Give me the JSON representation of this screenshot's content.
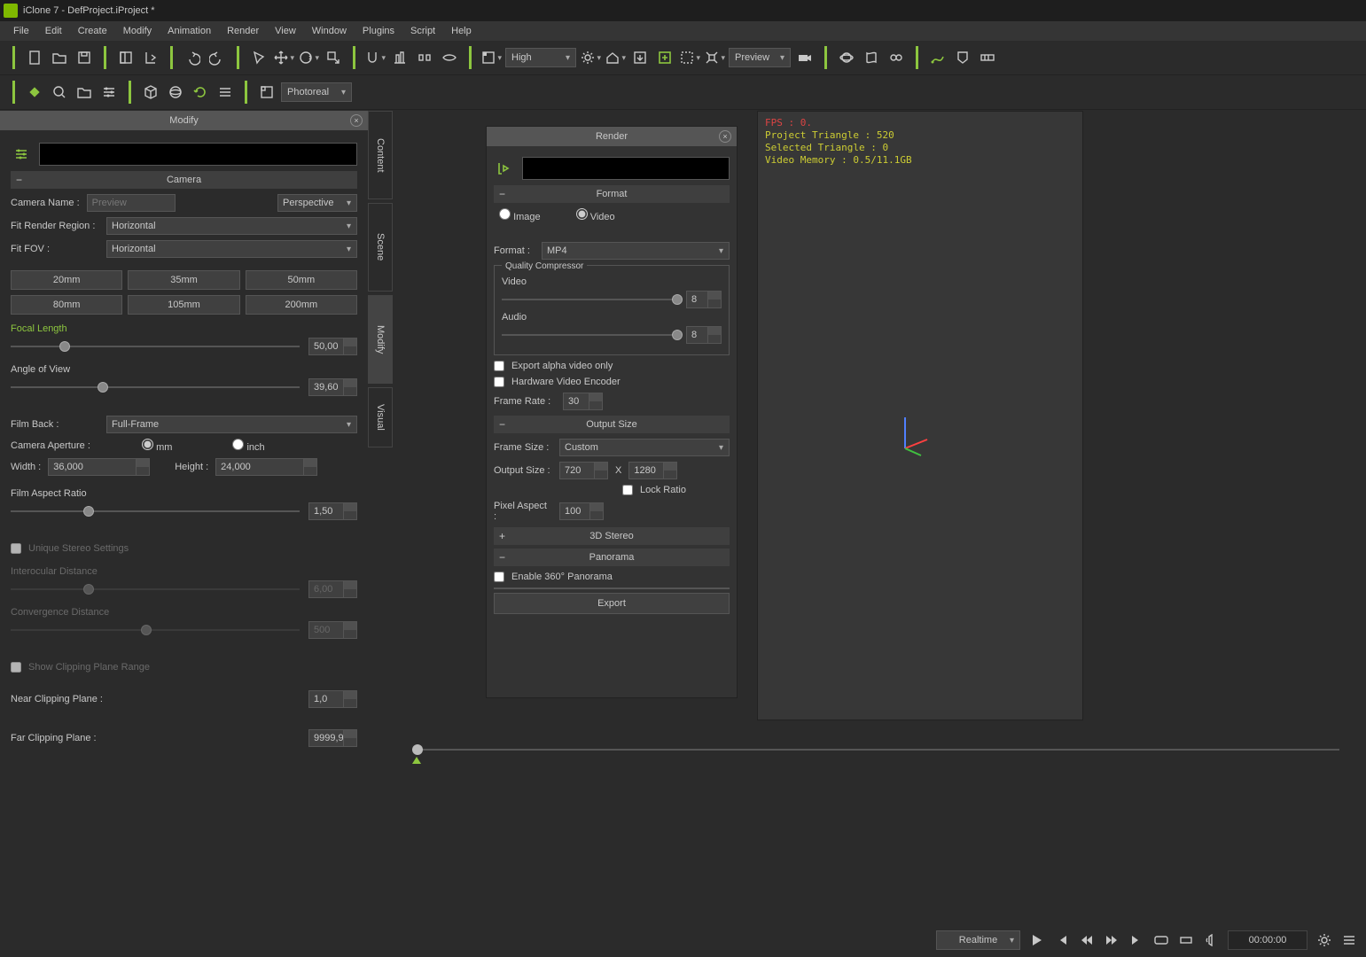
{
  "title": "iClone 7 - DefProject.iProject *",
  "menubar": [
    "File",
    "Edit",
    "Create",
    "Modify",
    "Animation",
    "Render",
    "View",
    "Window",
    "Plugins",
    "Script",
    "Help"
  ],
  "toolbar": {
    "quality_dropdown": "High",
    "preview_dropdown": "Preview",
    "shade_dropdown": "Photoreal"
  },
  "side_tabs": [
    "Content",
    "Scene",
    "Modify",
    "Visual"
  ],
  "modify": {
    "panel_title": "Modify",
    "search_value": "",
    "sections": {
      "camera": {
        "title": "Camera",
        "name_label": "Camera Name :",
        "name_value": "Preview",
        "projection": "Perspective",
        "fit_region_label": "Fit Render Region :",
        "fit_region_value": "Horizontal",
        "fit_fov_label": "Fit FOV :",
        "fit_fov_value": "Horizontal",
        "presets": [
          "20mm",
          "35mm",
          "50mm",
          "80mm",
          "105mm",
          "200mm"
        ],
        "focal_label": "Focal Length",
        "focal_value": "50,00",
        "aov_label": "Angle of View",
        "aov_value": "39,60",
        "film_back_label": "Film Back :",
        "film_back_value": "Full-Frame",
        "aperture_label": "Camera Aperture :",
        "unit_mm": "mm",
        "unit_inch": "inch",
        "width_label": "Width :",
        "width_value": "36,000",
        "height_label": "Height :",
        "height_value": "24,000",
        "aspect_label": "Film Aspect Ratio",
        "aspect_value": "1,50",
        "unique_stereo": "Unique Stereo Settings",
        "interocular_label": "Interocular Distance",
        "interocular_value": "6,00",
        "convergence_label": "Convergence Distance",
        "convergence_value": "500",
        "show_clip": "Show Clipping Plane Range",
        "near_clip_label": "Near Clipping Plane :",
        "near_clip_value": "1,0",
        "far_clip_label": "Far Clipping Plane :",
        "far_clip_value": "9999,9"
      }
    }
  },
  "render": {
    "panel_title": "Render",
    "format_hdr": "Format",
    "image": "Image",
    "video": "Video",
    "format_label": "Format :",
    "format_value": "MP4",
    "quality_comp": "Quality Compressor",
    "video_q_label": "Video",
    "video_q": "8",
    "audio_q_label": "Audio",
    "audio_q": "8",
    "export_alpha": "Export alpha video only",
    "hw_encoder": "Hardware Video Encoder",
    "frame_rate_label": "Frame Rate :",
    "frame_rate": "30",
    "output_size_hdr": "Output Size",
    "frame_size_label": "Frame Size :",
    "frame_size_value": "Custom",
    "output_size_label": "Output Size :",
    "out_w": "720",
    "out_h": "1280",
    "x": "X",
    "lock_ratio": "Lock Ratio",
    "pixel_aspect_label": "Pixel Aspect :",
    "pixel_aspect": "100",
    "stereo_hdr": "3D Stereo",
    "panorama_hdr": "Panorama",
    "enable_pano": "Enable 360° Panorama",
    "export_btn": "Export"
  },
  "viewport": {
    "fps": "FPS : 0.",
    "proj_tri": "Project Triangle : 520",
    "sel_tri": "Selected Triangle : 0",
    "vram": "Video Memory : 0.5/11.1GB"
  },
  "transport": {
    "mode": "Realtime",
    "timecode": "00:00:00"
  }
}
